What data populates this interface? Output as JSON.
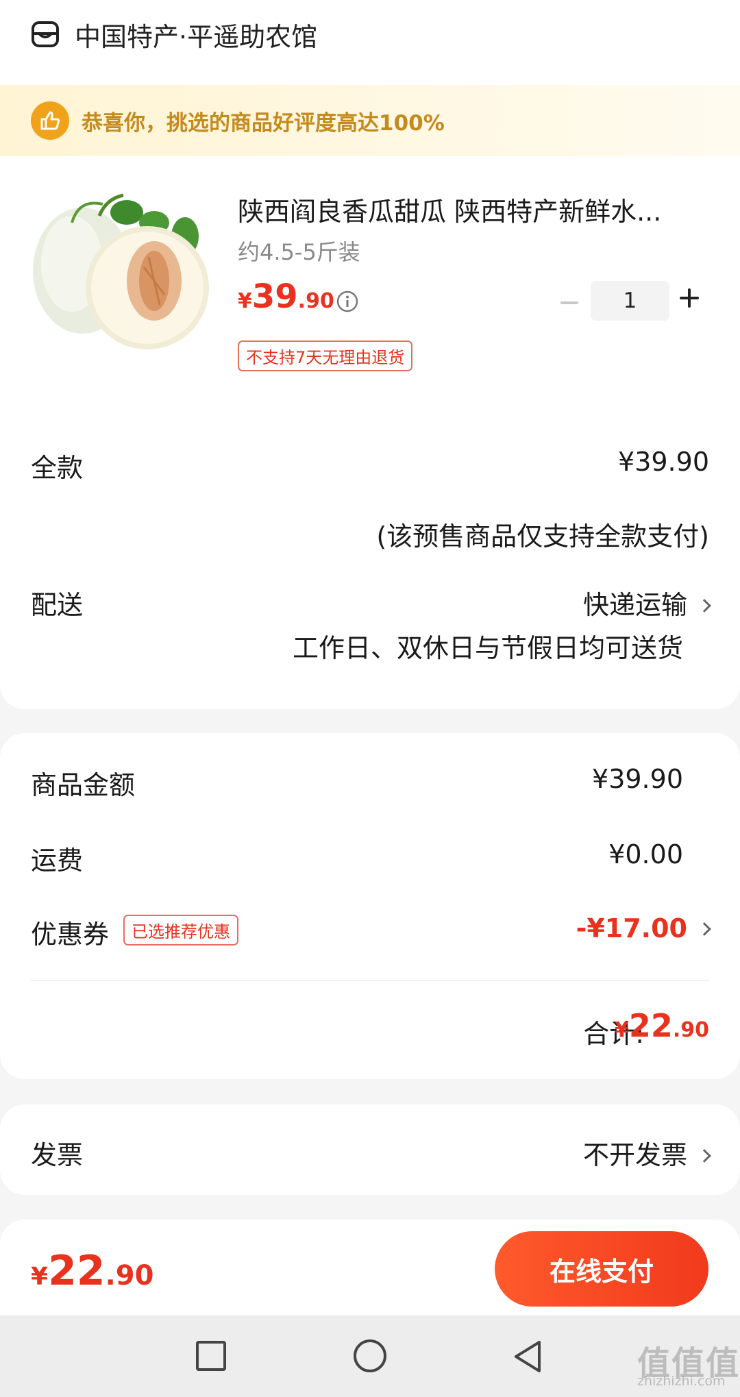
{
  "store": {
    "name": "中国特产·平遥助农馆",
    "icon": "store-icon"
  },
  "banner": {
    "text": "恭喜你，挑选的商品好评度高达100%",
    "icon": "thumbs-up-icon",
    "color": "#c48a1c"
  },
  "product": {
    "title": "陕西阎良香瓜甜瓜 陕西特产新鲜水...",
    "spec": "约4.5-5斤装",
    "price": {
      "currency": "¥",
      "integer": "39",
      "decimal": ".90"
    },
    "tag": "不支持7天无理由退货",
    "quantity": "1",
    "image": "melon-image"
  },
  "payment_mode": {
    "label": "全款",
    "value": "¥39.90",
    "note": "(该预售商品仅支持全款支付)"
  },
  "delivery": {
    "label": "配送",
    "method": "快递运输",
    "note": "工作日、双休日与节假日均可送货"
  },
  "summary": {
    "goods_label": "商品金额",
    "goods_value": "¥39.90",
    "shipping_label": "运费",
    "shipping_value": "¥0.00",
    "coupon_label": "优惠券",
    "coupon_tag": "已选推荐优惠",
    "coupon_value": "-¥17.00",
    "total_label": "合计:",
    "total": {
      "currency": "¥",
      "integer": "22",
      "decimal": ".90"
    }
  },
  "invoice": {
    "label": "发票",
    "value": "不开发票"
  },
  "bottom": {
    "pay_amount": {
      "currency": "¥",
      "integer": "22",
      "decimal": ".90"
    },
    "pay_button": "在线支付"
  },
  "watermark": {
    "glyphs": "值值值",
    "url": "zhizhizhi.com"
  },
  "colors": {
    "accent": "#e8321e",
    "banner_text": "#c48a1c",
    "button": "#f13a1c"
  }
}
